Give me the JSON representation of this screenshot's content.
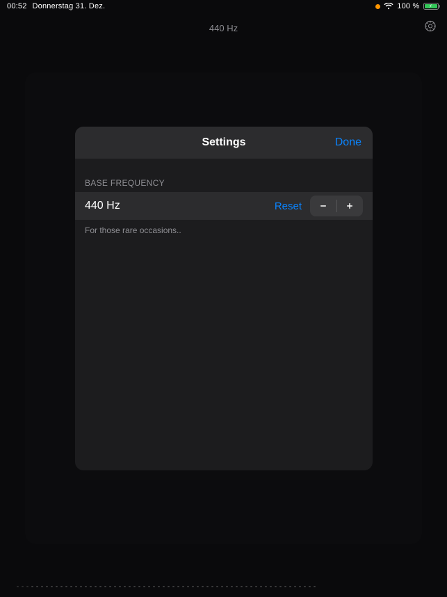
{
  "status": {
    "time": "00:52",
    "date": "Donnerstag 31. Dez.",
    "battery_pct": "100 %"
  },
  "header": {
    "title": "440 Hz"
  },
  "modal": {
    "title": "Settings",
    "done_label": "Done",
    "section_header": "BASE FREQUENCY",
    "value": "440 Hz",
    "reset_label": "Reset",
    "footer": "For those rare occasions.."
  }
}
